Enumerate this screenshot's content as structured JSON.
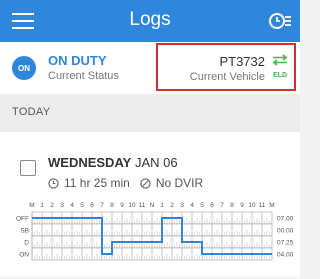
{
  "app": {
    "title": "Logs",
    "menu_icon": "hamburger-menu-icon",
    "clock_icon": "clock-icon",
    "accent": "#2f86dd"
  },
  "status": {
    "badge": "ON",
    "label": "ON DUTY",
    "sub": "Current Status"
  },
  "vehicle": {
    "id": "PT3732",
    "sub": "Current Vehicle",
    "eld": "ELD",
    "swap_icon": "swap-arrows-icon",
    "highlight_color": "#d32f2f"
  },
  "section": {
    "label": "TODAY"
  },
  "log": {
    "day": "WEDNESDAY",
    "date": "JAN 06",
    "duration": "11 hr 25 min",
    "dvir": "No DVIR",
    "duration_icon": "clock-icon",
    "dvir_icon": "no-dvir-icon",
    "graph": {
      "hour_labels": [
        "M",
        "1",
        "2",
        "3",
        "4",
        "5",
        "6",
        "7",
        "8",
        "9",
        "10",
        "11",
        "N",
        "1",
        "2",
        "3",
        "4",
        "5",
        "6",
        "7",
        "8",
        "9",
        "10",
        "11",
        "M"
      ],
      "rows": [
        "OFF",
        "SB",
        "D",
        "ON"
      ],
      "totals": [
        "07.00",
        "00.00",
        "07.25",
        "04.00"
      ],
      "segments": [
        {
          "row": "OFF",
          "start": 0,
          "end": 7
        },
        {
          "row": "ON",
          "start": 7,
          "end": 8
        },
        {
          "row": "D",
          "start": 8,
          "end": 13
        },
        {
          "row": "OFF",
          "start": 13,
          "end": 15
        },
        {
          "row": "D",
          "start": 15,
          "end": 17
        },
        {
          "row": "ON",
          "start": 17,
          "end": 24
        }
      ]
    }
  }
}
